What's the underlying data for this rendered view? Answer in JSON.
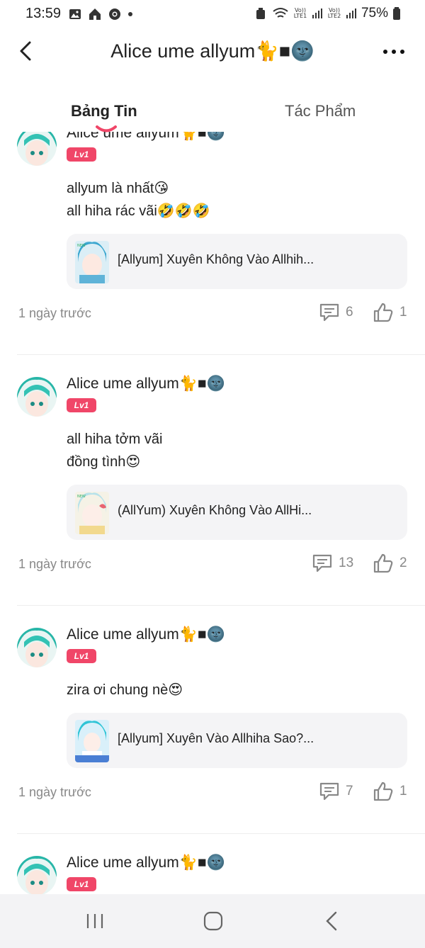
{
  "status_bar": {
    "time": "13:59",
    "battery": "75%",
    "net1": "Vo)) LTE1",
    "net2": "Vo)) LTE2"
  },
  "header": {
    "title": "Alice ume allyum🐈■🌚"
  },
  "tabs": [
    {
      "label": "Bảng Tin",
      "active": true
    },
    {
      "label": "Tác Phẩm",
      "active": false
    }
  ],
  "colors": {
    "accent": "#f04668",
    "muted": "#888888",
    "card_bg": "#f4f4f6"
  },
  "posts": [
    {
      "author": "Alice ume allyum🐈■🌚",
      "level": "Lv1",
      "content": [
        "allyum là nhất😘",
        "all hiha rác vãi🤣🤣🤣"
      ],
      "work_title": "[Allyum] Xuyên Không Vào Allhih...",
      "time": "1 ngày trước",
      "comments": "6",
      "likes": "1"
    },
    {
      "author": "Alice ume allyum🐈■🌚",
      "level": "Lv1",
      "content": [
        "all hiha tởm vãi",
        "đồng tình😍"
      ],
      "work_title": "(AllYum) Xuyên Không Vào AllHi...",
      "time": "1 ngày trước",
      "comments": "13",
      "likes": "2"
    },
    {
      "author": "Alice ume allyum🐈■🌚",
      "level": "Lv1",
      "content": [
        "zira ơi chung nè😍"
      ],
      "work_title": "[Allyum] Xuyên Vào Allhiha Sao?...",
      "time": "1 ngày trước",
      "comments": "7",
      "likes": "1"
    },
    {
      "author": "Alice ume allyum🐈■🌚",
      "level": "Lv1"
    }
  ],
  "icons": {
    "back": "chevron-left-icon",
    "more": "more-dots-icon",
    "comment": "comment-icon",
    "like": "thumbs-up-icon",
    "nav_recents": "recent-apps-icon",
    "nav_home": "home-icon",
    "nav_back": "back-icon"
  }
}
